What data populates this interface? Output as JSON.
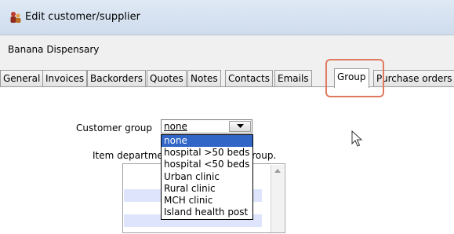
{
  "window": {
    "title": "Edit customer/supplier",
    "icon": "people-icon"
  },
  "record_name": "Banana Dispensary",
  "tabs": [
    {
      "label": "General",
      "active": false
    },
    {
      "label": "Invoices",
      "active": false
    },
    {
      "label": "Backorders",
      "active": false
    },
    {
      "label": "Quotes",
      "active": false
    },
    {
      "label": "Notes",
      "active": false
    },
    {
      "label": "Contacts",
      "active": false
    },
    {
      "label": "Emails",
      "active": false
    },
    {
      "label": "Group",
      "active": true
    },
    {
      "label": "Purchase orders",
      "active": false
    }
  ],
  "group_tab": {
    "customer_group_label": "Customer group",
    "customer_group_value": "none",
    "dropdown_options": [
      "none",
      "hospital >50 beds",
      "hospital <50 beds",
      "Urban clinic",
      "Rural clinic",
      "MCH clinic",
      "Island health post"
    ],
    "selected_index": 0,
    "dept_label_left": "Item departmen",
    "dept_label_right": "plied to this group."
  },
  "colors": {
    "highlight_box": "#e07a5f",
    "selection": "#3166c7",
    "alt_row": "#dde4fb"
  }
}
